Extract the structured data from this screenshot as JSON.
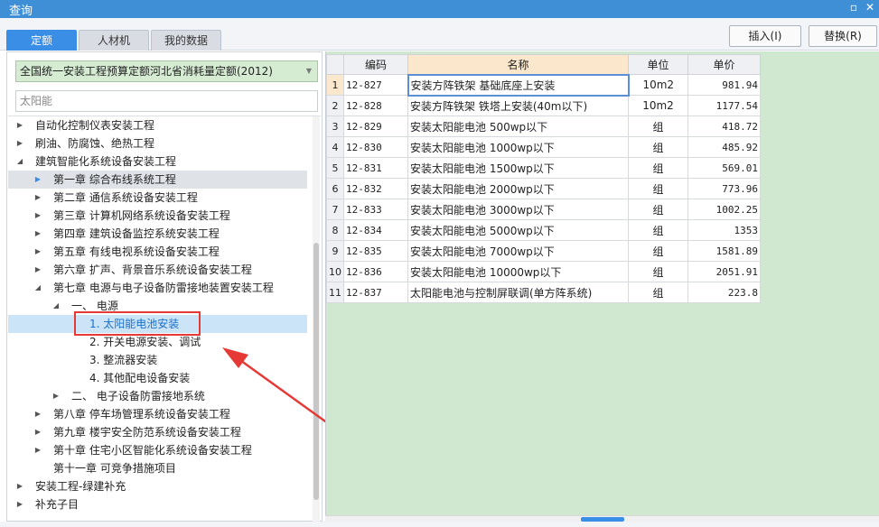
{
  "window": {
    "title": "查询"
  },
  "tabs": [
    {
      "label": "定额"
    },
    {
      "label": "人材机"
    },
    {
      "label": "我的数据"
    }
  ],
  "toolbar": {
    "insert_label": "插入(I)",
    "replace_label": "替换(R)"
  },
  "library": {
    "selected": "全国统一安装工程预算定额河北省消耗量定额(2012)"
  },
  "search": {
    "value": "太阳能"
  },
  "tree": [
    {
      "label": "自动化控制仪表安装工程",
      "toggle": "▶"
    },
    {
      "label": "刷油、防腐蚀、绝热工程",
      "toggle": "▶"
    },
    {
      "label": "建筑智能化系统设备安装工程",
      "toggle": "◢"
    },
    {
      "label": "第一章 综合布线系统工程",
      "toggle": "▶"
    },
    {
      "label": "第二章 通信系统设备安装工程",
      "toggle": "▶"
    },
    {
      "label": "第三章 计算机网络系统设备安装工程",
      "toggle": "▶"
    },
    {
      "label": "第四章 建筑设备监控系统安装工程",
      "toggle": "▶"
    },
    {
      "label": "第五章 有线电视系统设备安装工程",
      "toggle": "▶"
    },
    {
      "label": "第六章 扩声、背景音乐系统设备安装工程",
      "toggle": "▶"
    },
    {
      "label": "第七章 电源与电子设备防雷接地装置安装工程",
      "toggle": "◢"
    },
    {
      "label": "一、 电源",
      "toggle": "◢"
    },
    {
      "label": "1. 太阳能电池安装",
      "toggle": ""
    },
    {
      "label": "2. 开关电源安装、调试",
      "toggle": ""
    },
    {
      "label": "3. 整流器安装",
      "toggle": ""
    },
    {
      "label": "4. 其他配电设备安装",
      "toggle": ""
    },
    {
      "label": "二、 电子设备防雷接地系统",
      "toggle": "▶"
    },
    {
      "label": "第八章 停车场管理系统设备安装工程",
      "toggle": "▶"
    },
    {
      "label": "第九章 楼宇安全防范系统设备安装工程",
      "toggle": "▶"
    },
    {
      "label": "第十章 住宅小区智能化系统设备安装工程",
      "toggle": "▶"
    },
    {
      "label": "第十一章 可竞争措施项目",
      "toggle": ""
    },
    {
      "label": "安装工程-绿建补充",
      "toggle": "▶"
    },
    {
      "label": "补充子目",
      "toggle": "▶"
    }
  ],
  "table": {
    "headers": {
      "code": "编码",
      "name": "名称",
      "unit": "单位",
      "price": "单价"
    },
    "rows": [
      {
        "no": "1",
        "code": "12-827",
        "name": "安装方阵铁架 基础底座上安装",
        "unit": "10m2",
        "price": "981.94"
      },
      {
        "no": "2",
        "code": "12-828",
        "name": "安装方阵铁架 铁塔上安装(40m以下)",
        "unit": "10m2",
        "price": "1177.54"
      },
      {
        "no": "3",
        "code": "12-829",
        "name": "安装太阳能电池 500wp以下",
        "unit": "组",
        "price": "418.72"
      },
      {
        "no": "4",
        "code": "12-830",
        "name": "安装太阳能电池 1000wp以下",
        "unit": "组",
        "price": "485.92"
      },
      {
        "no": "5",
        "code": "12-831",
        "name": "安装太阳能电池 1500wp以下",
        "unit": "组",
        "price": "569.01"
      },
      {
        "no": "6",
        "code": "12-832",
        "name": "安装太阳能电池 2000wp以下",
        "unit": "组",
        "price": "773.96"
      },
      {
        "no": "7",
        "code": "12-833",
        "name": "安装太阳能电池 3000wp以下",
        "unit": "组",
        "price": "1002.25"
      },
      {
        "no": "8",
        "code": "12-834",
        "name": "安装太阳能电池 5000wp以下",
        "unit": "组",
        "price": "1353"
      },
      {
        "no": "9",
        "code": "12-835",
        "name": "安装太阳能电池 7000wp以下",
        "unit": "组",
        "price": "1581.89"
      },
      {
        "no": "10",
        "code": "12-836",
        "name": "安装太阳能电池 10000wp以下",
        "unit": "组",
        "price": "2051.91"
      },
      {
        "no": "11",
        "code": "12-837",
        "name": "太阳能电池与控制屏联调(单方阵系统)",
        "unit": "组",
        "price": "223.8"
      }
    ]
  }
}
